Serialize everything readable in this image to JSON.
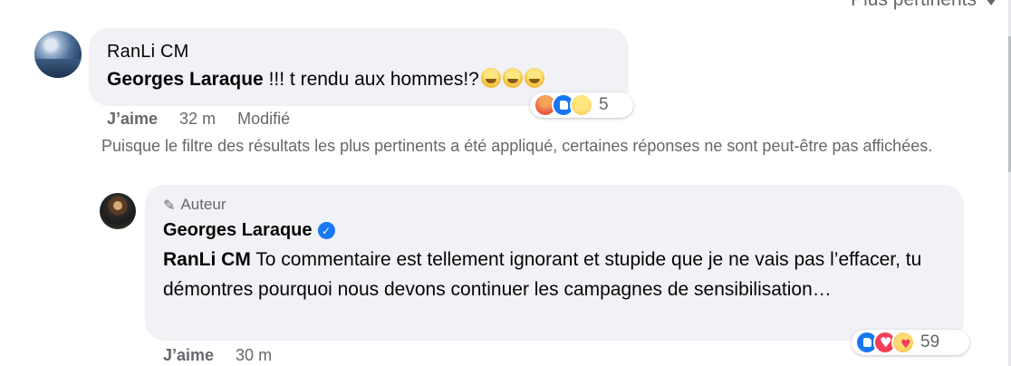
{
  "header": {
    "sort_label": "Plus pertinents"
  },
  "comment": {
    "author": "RanLi CM",
    "mention": "Georges Laraque",
    "text": " !!! t rendu aux hommes!?",
    "emoji_icon": "grinning-sweat-emoji",
    "reaction_icons": [
      "angry-icon",
      "like-icon",
      "sad-icon"
    ],
    "reaction_count": "5",
    "actions": {
      "like": "J’aime",
      "time": "32 m",
      "edited": "Modifié"
    }
  },
  "notice": "Puisque le filtre des résultats les plus pertinents a été appliqué, certaines réponses ne sont peut-être pas affichées.",
  "reply": {
    "badge": "Auteur",
    "author": "Georges Laraque",
    "mention": "RanLi CM",
    "text": " To commentaire est tellement ignorant et stupide que je ne vais pas l’effacer, tu démontres pourquoi nous devons continuer les campagnes de sensibilisation…",
    "reaction_icons": [
      "like-icon",
      "love-icon",
      "care-icon"
    ],
    "reaction_count": "59",
    "actions": {
      "like": "J’aime",
      "time": "30 m"
    }
  },
  "colors": {
    "bubble": "#f0f2f5",
    "secondary_text": "#65676b",
    "brand": "#1877f2"
  }
}
